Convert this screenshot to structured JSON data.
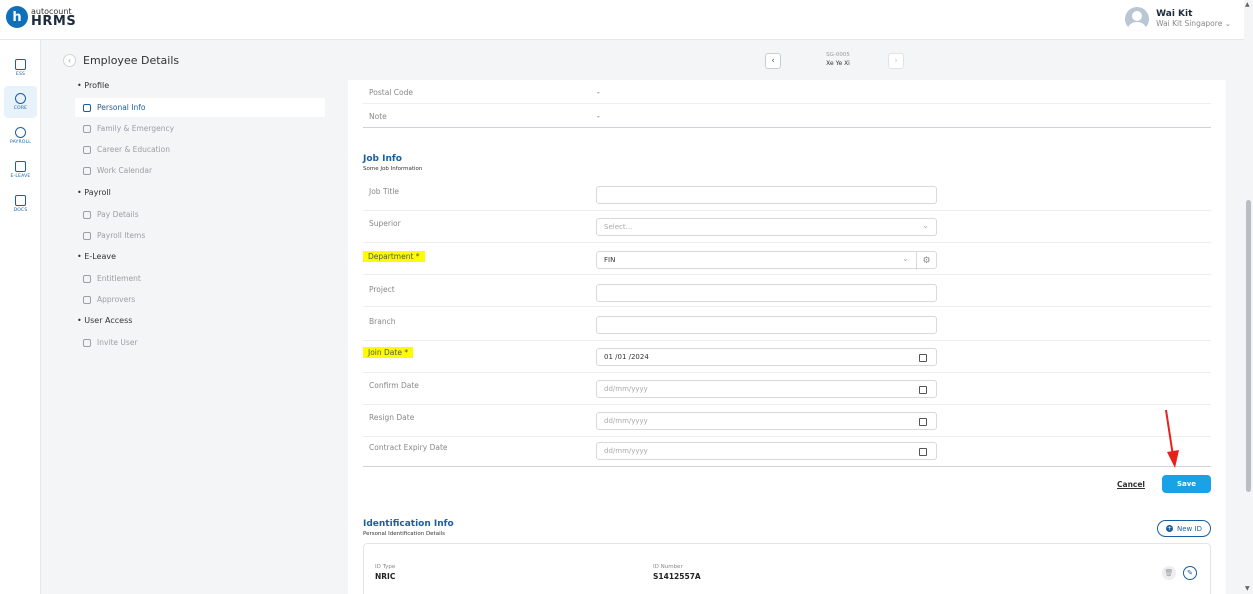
{
  "header": {
    "logo_top": "autocount",
    "logo_bottom": "HRMS",
    "user_name": "Wai Kit",
    "user_org": "Wai Kit Singapore"
  },
  "rail": [
    {
      "label": "ESS",
      "icon": "ess-icon",
      "active": false
    },
    {
      "label": "CORE",
      "icon": "core-icon",
      "active": true
    },
    {
      "label": "PAYROLL",
      "icon": "dollar-icon",
      "active": false
    },
    {
      "label": "E-LEAVE",
      "icon": "calendar-icon",
      "active": false
    },
    {
      "label": "DOCS",
      "icon": "document-icon",
      "active": false
    }
  ],
  "nav": {
    "title": "Employee Details",
    "groups": {
      "profile": "Profile",
      "payroll": "Payroll",
      "eleave": "E-Leave",
      "user_access": "User Access"
    },
    "items": {
      "personal_info": "Personal Info",
      "family_emergency": "Family & Emergency",
      "career_education": "Career & Education",
      "work_calendar": "Work Calendar",
      "pay_details": "Pay Details",
      "payroll_items": "Payroll Items",
      "entitlement": "Entitlement",
      "approvers": "Approvers",
      "invite_user": "Invite User"
    }
  },
  "employee": {
    "code": "SG-0005",
    "name": "Xe Ye Xi"
  },
  "address": {
    "postal_code_label": "Postal Code",
    "postal_code_value": "-",
    "note_label": "Note",
    "note_value": "-"
  },
  "job_info": {
    "title": "Job Info",
    "subtitle": "Some Job Information",
    "job_title_label": "Job Title",
    "job_title_value": "",
    "superior_label": "Superior",
    "superior_placeholder": "Select...",
    "department_label": "Department *",
    "department_value": "FIN",
    "project_label": "Project",
    "project_value": "",
    "branch_label": "Branch",
    "branch_value": "",
    "join_date_label": "Join Date *",
    "join_date_value": "01 /01 /2024",
    "confirm_date_label": "Confirm Date",
    "resign_date_label": "Resign Date",
    "contract_expiry_label": "Contract Expiry Date",
    "date_placeholder": "dd/mm/yyyy",
    "cancel_label": "Cancel",
    "save_label": "Save"
  },
  "identification": {
    "title": "Identification Info",
    "subtitle": "Personal Identification Details",
    "new_id_label": "New ID",
    "id_type_label": "ID Type",
    "id_type_value": "NRIC",
    "id_number_label": "ID Number",
    "id_number_value": "S1412557A"
  },
  "colors": {
    "primary": "#1b5fa0",
    "save": "#1aa1e6",
    "highlight": "#fdfc00",
    "annotation_arrow": "#e8221b"
  }
}
